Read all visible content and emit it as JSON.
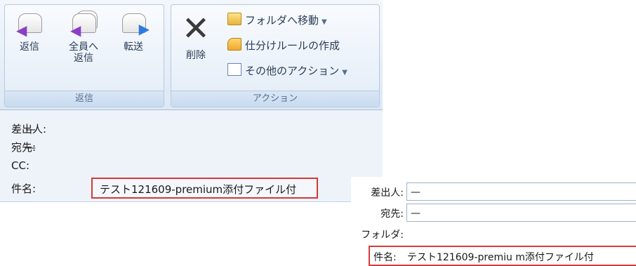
{
  "ribbon": {
    "reply_group": {
      "label": "返信",
      "buttons": [
        {
          "label": "返信",
          "icon": "reply-icon"
        },
        {
          "label_line1": "全員へ",
          "label_line2": "返信",
          "icon": "reply-all-icon"
        },
        {
          "label": "転送",
          "icon": "forward-icon"
        }
      ]
    },
    "action_group": {
      "label": "アクション",
      "delete_label": "削除",
      "move_label": "フォルダへ移動",
      "rules_label": "仕分けルールの作成",
      "other_label": "その他のアクション"
    }
  },
  "message_header": {
    "from_label": "差出人:",
    "from_value": "—",
    "to_label": "宛先:",
    "to_value": "—",
    "cc_label": "CC:",
    "subject_label": "件名:",
    "subject_value": "テスト121609-premium添付ファイル付"
  },
  "form2": {
    "from_label": "差出人:",
    "from_value": "—",
    "to_label": "宛先:",
    "to_value": "—",
    "folder_label": "フォルダ:",
    "subject_label": "件名:",
    "subject_value": "テスト121609-premiu m添付ファイル付"
  },
  "colors": {
    "highlight": "#d43a3a",
    "ribbon_text": "#2a3d55"
  }
}
